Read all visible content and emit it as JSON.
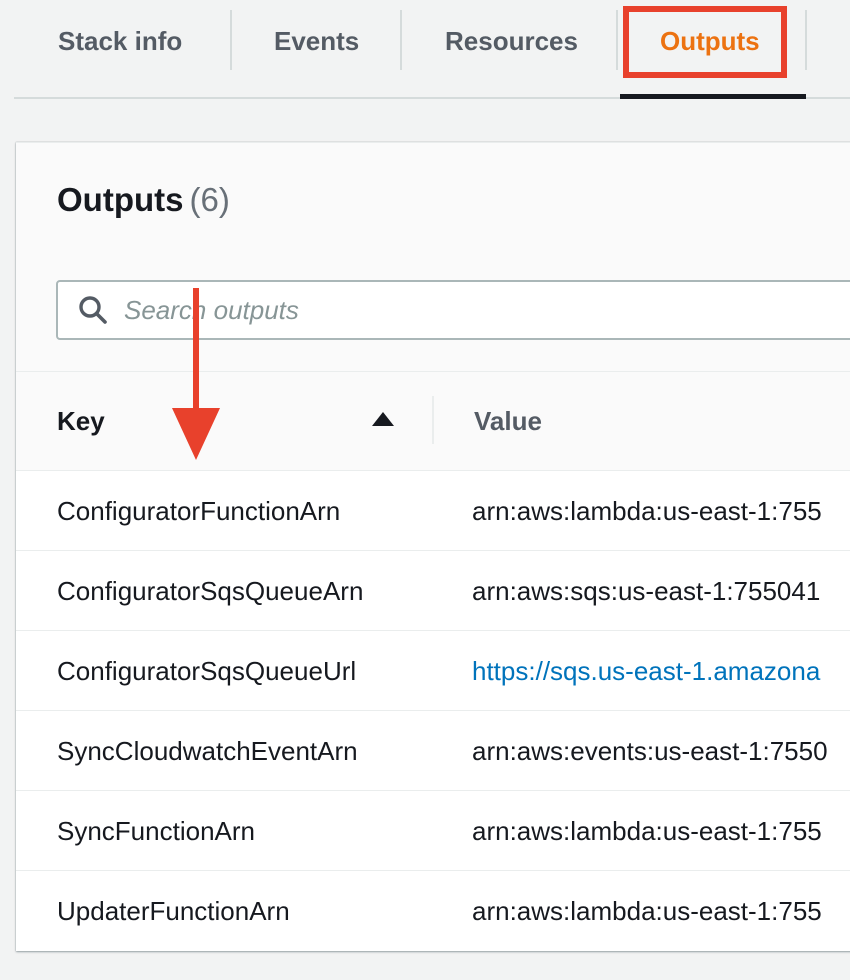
{
  "tabs": [
    {
      "label": "Stack info",
      "active": false
    },
    {
      "label": "Events",
      "active": false
    },
    {
      "label": "Resources",
      "active": false
    },
    {
      "label": "Outputs",
      "active": true
    }
  ],
  "outputs_panel": {
    "title": "Outputs",
    "count": "(6)",
    "search": {
      "placeholder": "Search outputs",
      "value": ""
    },
    "columns": {
      "key": "Key",
      "value": "Value"
    },
    "sort": "Key ascending",
    "rows": [
      {
        "key": "ConfiguratorFunctionArn",
        "value": "arn:aws:lambda:us-east-1:755",
        "is_link": false
      },
      {
        "key": "ConfiguratorSqsQueueArn",
        "value": "arn:aws:sqs:us-east-1:755041",
        "is_link": false
      },
      {
        "key": "ConfiguratorSqsQueueUrl",
        "value": "https://sqs.us-east-1.amazona",
        "is_link": true
      },
      {
        "key": "SyncCloudwatchEventArn",
        "value": "arn:aws:events:us-east-1:7550",
        "is_link": false
      },
      {
        "key": "SyncFunctionArn",
        "value": "arn:aws:lambda:us-east-1:755",
        "is_link": false
      },
      {
        "key": "UpdaterFunctionArn",
        "value": "arn:aws:lambda:us-east-1:755",
        "is_link": false
      }
    ]
  },
  "colors": {
    "active_tab": "#ec7211",
    "annotation_red": "#e8412c",
    "link": "#0073bb",
    "page_background": "#f2f3f3"
  },
  "icons": {
    "search": "search-icon",
    "sort": "sort-ascending-icon",
    "annotation": "down-arrow-icon"
  }
}
